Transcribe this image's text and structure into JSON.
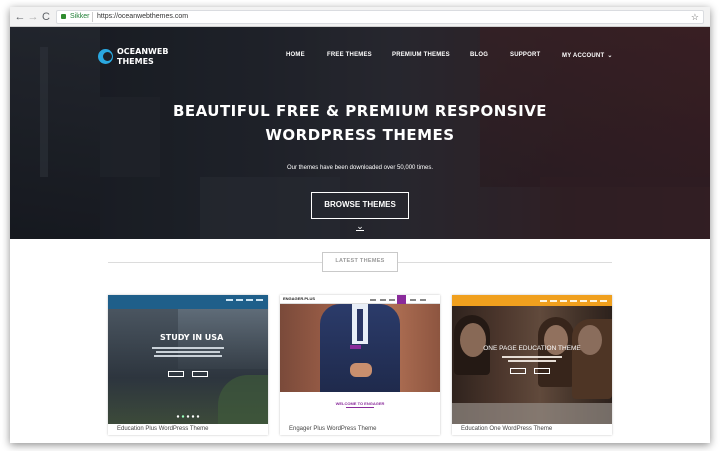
{
  "browser": {
    "nav_back": "←",
    "nav_forward": "→",
    "nav_reload": "C",
    "nav_home": "⌂",
    "secure_label": "Sikker",
    "url": "https://oceanwebthemes.com",
    "bookmark_icon": "☆"
  },
  "site": {
    "logo_line1": "OCEANWEB",
    "logo_line2": "THEMES",
    "accent": "#2aa8e0"
  },
  "nav": {
    "home": "HOME",
    "free_themes": "FREE THEMES",
    "premium_themes": "PREMIUM THEMES",
    "blog": "BLOG",
    "support": "SUPPORT",
    "my_account": "MY ACCOUNT",
    "chevron": "⌄"
  },
  "hero": {
    "headline_line1": "BEAUTIFUL FREE & PREMIUM RESPONSIVE",
    "headline_line2": "WORDPRESS THEMES",
    "subline": "Our themes have been downloaded over 50,000 times.",
    "browse_button": "BROWSE THEMES",
    "scroll_icon": "⌄"
  },
  "latest": {
    "label": "LATEST THEMES"
  },
  "cards": [
    {
      "title": "Education Plus WordPress Theme",
      "preview_heading": "STUDY IN USA"
    },
    {
      "title": "Engager Plus WordPress Theme",
      "preview_brand": "ENGAGER.PLUS",
      "preview_welcome": "WELCOME TO ENGAGER"
    },
    {
      "title": "Education One WordPress Theme",
      "preview_heading": "ONE PAGE EDUCATION THEME"
    }
  ]
}
